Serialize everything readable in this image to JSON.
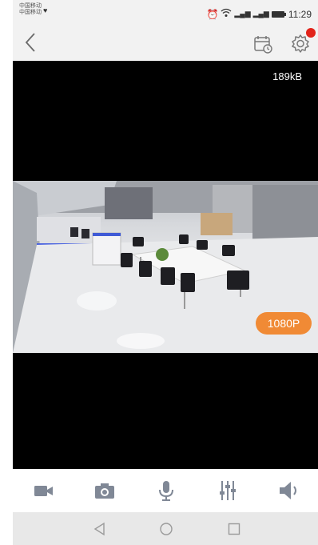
{
  "status_bar": {
    "carrier1": "中国移动",
    "carrier2": "中国移动",
    "signal1": "⁴ᴳ",
    "signal2": "⁴ᴳ",
    "time": "11:29"
  },
  "nav": {
    "back_glyph": "‹"
  },
  "player": {
    "bitrate": "189kB",
    "resolution": "1080P"
  },
  "toolbar": {
    "items": [
      "record-video",
      "snapshot",
      "microphone",
      "image-settings",
      "speaker"
    ]
  },
  "colors": {
    "accent": "#f08a35",
    "notification": "#e2231a",
    "icon_gray": "#808896"
  }
}
